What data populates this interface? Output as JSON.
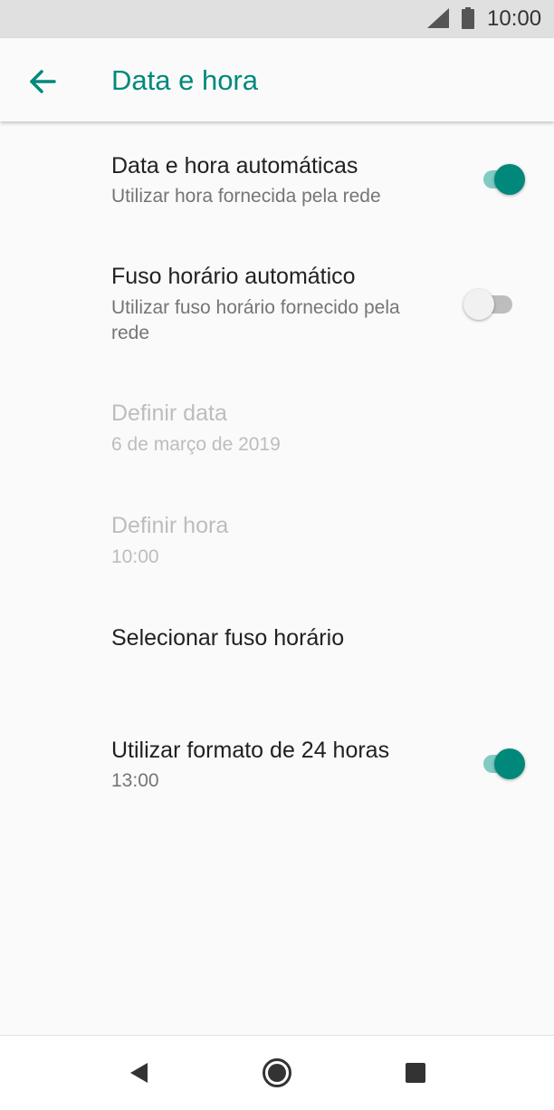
{
  "status_bar": {
    "time": "10:00",
    "icons": [
      "signal-icon",
      "battery-icon"
    ]
  },
  "app_bar": {
    "title": "Data e hora",
    "back_icon": "arrow-left-icon"
  },
  "settings": [
    {
      "title": "Data e hora automáticas",
      "summary": "Utilizar hora fornecida pela rede",
      "switch": "on",
      "enabled": true
    },
    {
      "title": "Fuso horário automático",
      "summary": "Utilizar fuso horário fornecido pela rede",
      "switch": "off",
      "enabled": true
    },
    {
      "title": "Definir data",
      "summary": "6 de março de 2019",
      "enabled": false
    },
    {
      "title": "Definir hora",
      "summary": "10:00",
      "enabled": false
    },
    {
      "title": "Selecionar fuso horário",
      "enabled": true
    },
    {
      "title": "Utilizar formato de 24 horas",
      "summary": "13:00",
      "switch": "on",
      "enabled": true
    }
  ],
  "nav_bar": {
    "buttons": [
      "back-triangle-icon",
      "home-circle-icon",
      "recents-square-icon"
    ]
  },
  "colors": {
    "accent": "#00897b",
    "accent_track": "#80cbc4",
    "background": "#fafafa",
    "status_bar": "#e0e0e0",
    "disabled_text": "#bdbdbd",
    "secondary_text": "#757575"
  }
}
